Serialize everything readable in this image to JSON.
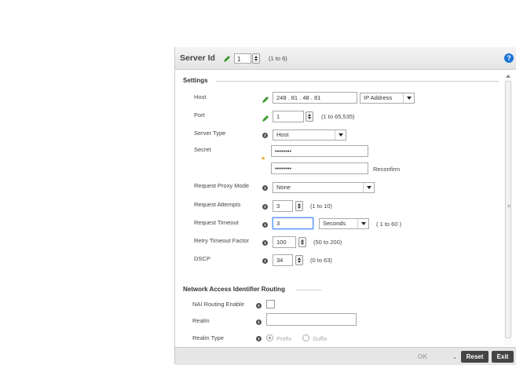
{
  "header": {
    "title": "Server Id",
    "server_id_value": "1",
    "server_id_range": "(1 to 6)",
    "help_glyph": "?"
  },
  "settings": {
    "section_title": "Settings",
    "host": {
      "label": "Host",
      "value": "248 . 81 . 48 . 81",
      "type": "IP Address"
    },
    "port": {
      "label": "Port",
      "value": "1",
      "range": "(1 to 65,535)"
    },
    "server_type": {
      "label": "Server Type",
      "value": "Host"
    },
    "secret": {
      "label": "Secret",
      "value": "••••••••",
      "confirm_value": "••••••••",
      "confirm_label": "Reconfirm"
    },
    "request_proxy_mode": {
      "label": "Request Proxy Mode",
      "value": "None"
    },
    "request_attempts": {
      "label": "Request Attempts",
      "value": "3",
      "range": "(1 to 10)"
    },
    "request_timeout": {
      "label": "Request Timeout",
      "value": "3",
      "unit": "Seconds",
      "range": "( 1 to 60 )"
    },
    "retry_timeout_factor": {
      "label": "Retry Timeout Factor",
      "value": "100",
      "range": "(50 to 200)"
    },
    "dscp": {
      "label": "DSCP",
      "value": "34",
      "range": "(0 to 63)"
    }
  },
  "nai": {
    "section_title": "Network Access Identifier Routing",
    "enable_label": "NAI Routing Enable",
    "realm_label": "Realm",
    "realm_value": "",
    "realm_type_label": "Realm Type",
    "prefix_label": "Prefix",
    "suffix_label": "Suffix"
  },
  "footer": {
    "ok_label": "OK",
    "reset_label": "Reset",
    "exit_label": "Exit"
  },
  "colors": {
    "help_blue": "#1a73d6",
    "pencil_green": "#3a9a2a",
    "required_star": "#f0a020",
    "button_dark": "#444444"
  }
}
